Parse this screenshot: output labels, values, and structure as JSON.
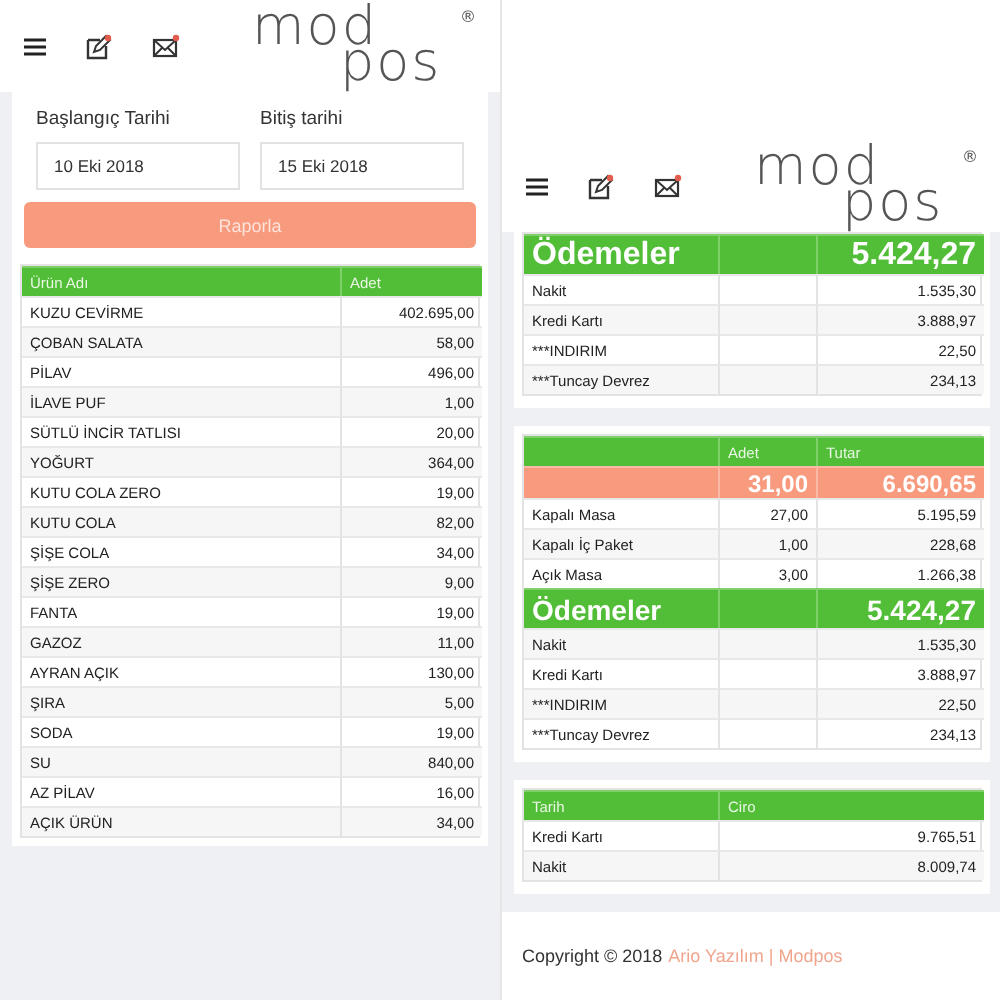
{
  "left": {
    "header": {
      "logo_top": "mod",
      "logo_bottom": "pos",
      "logo_mark": "®"
    },
    "filters": {
      "start_label": "Başlangıç Tarihi",
      "start_value": "10 Eki 2018",
      "end_label": "Bitiş tarihi",
      "end_value": "15 Eki 2018"
    },
    "report_button": "Raporla",
    "table": {
      "rows": [
        {
          "kind": "header",
          "cells": [
            "Ürün Adı",
            "Adet"
          ]
        },
        {
          "kind": "data",
          "cells": [
            "KUZU CEVİRME",
            "402.695,00"
          ]
        },
        {
          "kind": "data",
          "cells": [
            "ÇOBAN SALATA",
            "58,00"
          ]
        },
        {
          "kind": "data",
          "cells": [
            "PİLAV",
            "496,00"
          ]
        },
        {
          "kind": "data",
          "cells": [
            "İLAVE PUF",
            "1,00"
          ]
        },
        {
          "kind": "data",
          "cells": [
            "SÜTLÜ İNCİR TATLISI",
            "20,00"
          ]
        },
        {
          "kind": "data",
          "cells": [
            "YOĞURT",
            "364,00"
          ]
        },
        {
          "kind": "data",
          "cells": [
            "KUTU COLA ZERO",
            "19,00"
          ]
        },
        {
          "kind": "data",
          "cells": [
            "KUTU COLA",
            "82,00"
          ]
        },
        {
          "kind": "data",
          "cells": [
            "ŞİŞE COLA",
            "34,00"
          ]
        },
        {
          "kind": "data",
          "cells": [
            "ŞİŞE ZERO",
            "9,00"
          ]
        },
        {
          "kind": "data",
          "cells": [
            "FANTA",
            "19,00"
          ]
        },
        {
          "kind": "data",
          "cells": [
            "GAZOZ",
            "11,00"
          ]
        },
        {
          "kind": "data",
          "cells": [
            "AYRAN AÇIK",
            "130,00"
          ]
        },
        {
          "kind": "data",
          "cells": [
            "ŞIRA",
            "5,00"
          ]
        },
        {
          "kind": "data",
          "cells": [
            "SODA",
            "19,00"
          ]
        },
        {
          "kind": "data",
          "cells": [
            "SU",
            "840,00"
          ]
        },
        {
          "kind": "data",
          "cells": [
            "AZ PİLAV",
            "16,00"
          ]
        },
        {
          "kind": "data",
          "cells": [
            "AÇIK ÜRÜN",
            "34,00"
          ]
        }
      ]
    }
  },
  "right": {
    "header": {
      "logo_top": "mod",
      "logo_bottom": "pos",
      "logo_mark": "®"
    },
    "tables": [
      {
        "rows": [
          {
            "kind": "section",
            "cells": [
              "Ödemeler",
              null,
              "5.424,27"
            ]
          },
          {
            "kind": "data",
            "cells": [
              "Nakit",
              null,
              "1.535,30"
            ]
          },
          {
            "kind": "data",
            "cells": [
              "Kredi Kartı",
              null,
              "3.888,97"
            ]
          },
          {
            "kind": "data",
            "cells": [
              "***INDIRIM",
              null,
              "22,50"
            ]
          },
          {
            "kind": "data",
            "cells": [
              "***Tuncay Devrez",
              null,
              "234,13"
            ]
          }
        ]
      },
      {
        "rows": [
          {
            "kind": "header",
            "cells": [
              null,
              "Adet",
              "Tutar"
            ]
          },
          {
            "kind": "total",
            "cells": [
              null,
              "31,00",
              "6.690,65"
            ]
          },
          {
            "kind": "data",
            "cells": [
              "Kapalı Masa",
              "27,00",
              "5.195,59"
            ]
          },
          {
            "kind": "data",
            "cells": [
              "Kapalı İç Paket",
              "1,00",
              "228,68"
            ]
          },
          {
            "kind": "data",
            "cells": [
              "Açık Masa",
              "3,00",
              "1.266,38"
            ]
          },
          {
            "kind": "section",
            "cells": [
              "Ödemeler",
              null,
              "5.424,27"
            ]
          },
          {
            "kind": "data",
            "cells": [
              "Nakit",
              null,
              "1.535,30"
            ]
          },
          {
            "kind": "data",
            "cells": [
              "Kredi Kartı",
              null,
              "3.888,97"
            ]
          },
          {
            "kind": "data",
            "cells": [
              "***INDIRIM",
              null,
              "22,50"
            ]
          },
          {
            "kind": "data",
            "cells": [
              "***Tuncay Devrez",
              null,
              "234,13"
            ]
          }
        ]
      },
      {
        "rows": [
          {
            "kind": "header",
            "cells": [
              "Tarih",
              "Ciro"
            ]
          },
          {
            "kind": "data",
            "cells": [
              "Kredi Kartı",
              "9.765,51"
            ]
          },
          {
            "kind": "data",
            "cells": [
              "Nakit",
              "8.009,74"
            ]
          }
        ]
      }
    ],
    "footer": {
      "text": "Copyright © 2018",
      "link": "Ario Yazılım | Modpos"
    }
  }
}
